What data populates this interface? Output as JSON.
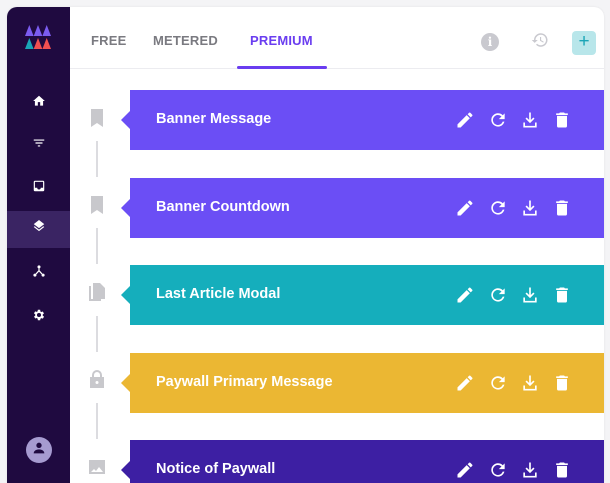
{
  "tabs": [
    {
      "label": "FREE"
    },
    {
      "label": "METERED"
    },
    {
      "label": "PREMIUM"
    }
  ],
  "active_tab": "PREMIUM",
  "add_button_label": "+",
  "info_icon_label": "i",
  "colors": {
    "sidebar": "#1f0a40",
    "accent": "#6a3df0",
    "purple": "#6b4ef5",
    "teal": "#15aebc",
    "yellow": "#ebb733",
    "indigo": "#3d1fa3"
  },
  "cards": [
    {
      "title": "Banner Message",
      "color": "#6b4ef5",
      "marker_icon": "bookmark-icon"
    },
    {
      "title": "Banner Countdown",
      "color": "#6b4ef5",
      "marker_icon": "bookmark-icon"
    },
    {
      "title": "Last Article Modal",
      "color": "#15aebc",
      "marker_icon": "file-copy-icon"
    },
    {
      "title": "Paywall Primary Message",
      "color": "#ebb733",
      "marker_icon": "lock-icon"
    },
    {
      "title": "Notice of Paywall",
      "color": "#3d1fa3",
      "marker_icon": "image-icon"
    }
  ],
  "sidebar_items": [
    {
      "icon": "home-icon",
      "active": false
    },
    {
      "icon": "filter-icon",
      "active": false
    },
    {
      "icon": "inbox-icon",
      "active": false
    },
    {
      "icon": "layers-icon",
      "active": true
    },
    {
      "icon": "flow-icon",
      "active": false
    },
    {
      "icon": "gear-icon",
      "active": false
    }
  ]
}
